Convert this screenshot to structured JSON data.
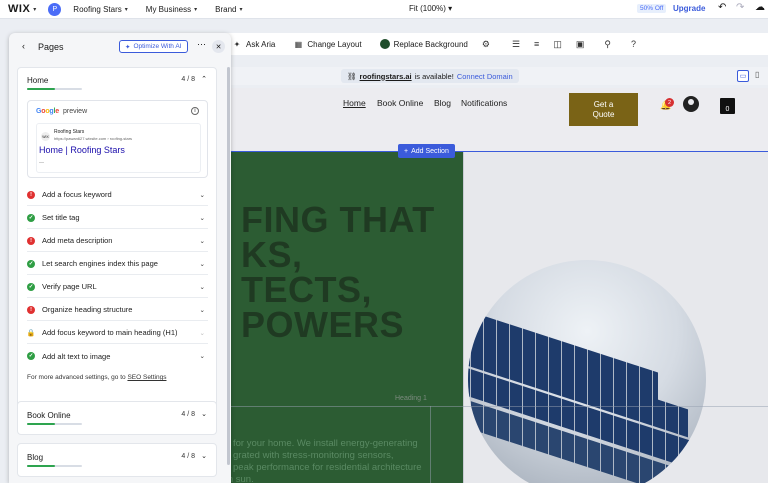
{
  "topbar": {
    "logo": "WIX",
    "avatar_letter": "P",
    "site_name": "Roofing Stars",
    "menu_business": "My Business",
    "menu_brand": "Brand",
    "zoom": "Fit (100%)",
    "discount_badge": "50% Off",
    "upgrade_label": "Upgrade"
  },
  "toolbar": {
    "ask_aria": "Ask Aria",
    "change_layout": "Change Layout",
    "replace_background": "Replace Background"
  },
  "domain_bar": {
    "domain": "roofingstars.ai",
    "available_text": "is available!",
    "connect_label": "Connect Domain"
  },
  "site": {
    "nav": [
      "Home",
      "Book Online",
      "Blog",
      "Notifications"
    ],
    "cta_label": "Get a Quote",
    "notification_count": "2",
    "cart_count": "0",
    "add_section_label": "Add Section",
    "hero_title_lines": [
      "FING THAT",
      "KS,",
      "TECTS,",
      "POWERS"
    ],
    "hero_body_lines": [
      "for your home. We install energy-generating",
      "grated with stress-monitoring sensors,",
      "peak performance for residential architecture",
      "under the Cape Town sun."
    ],
    "heading_tag": "Heading 1"
  },
  "panel": {
    "title": "Pages",
    "ai_button": "Optimize With AI",
    "cards": [
      {
        "title": "Home",
        "count": "4 / 8",
        "progress": 0.5
      },
      {
        "title": "Book Online",
        "count": "4 / 8",
        "progress": 0.5
      },
      {
        "title": "Blog",
        "count": "4 / 8",
        "progress": 0.5
      }
    ],
    "preview": {
      "label": "preview",
      "site_name": "Roofing Stars",
      "url": "https://pawan627.wixsite.com › roofing-stars",
      "title": "Home | Roofing Stars",
      "snippet": "—"
    },
    "checks": [
      {
        "label": "Add a focus keyword",
        "status": "err"
      },
      {
        "label": "Set title tag",
        "status": "ok"
      },
      {
        "label": "Add meta description",
        "status": "err"
      },
      {
        "label": "Let search engines index this page",
        "status": "ok"
      },
      {
        "label": "Verify page URL",
        "status": "ok"
      },
      {
        "label": "Organize heading structure",
        "status": "err"
      },
      {
        "label": "Add focus keyword to main heading (H1)",
        "status": "lock"
      },
      {
        "label": "Add alt text to image",
        "status": "ok"
      }
    ],
    "footnote_prefix": "For more advanced settings, go to ",
    "footnote_link": "SEO Settings"
  },
  "colors": {
    "accent": "#3b5bdb",
    "cta_bg": "#7a6316",
    "hero_green": "#2c5c33",
    "error": "#e03131",
    "ok": "#2f9e44"
  }
}
